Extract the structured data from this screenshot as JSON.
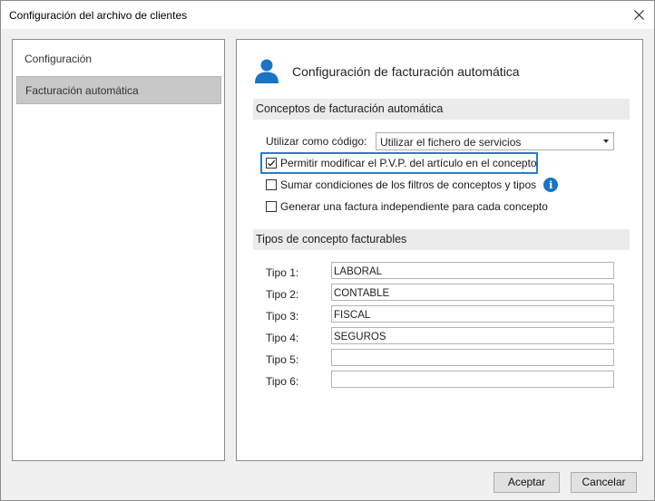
{
  "window": {
    "title": "Configuración del archivo de clientes"
  },
  "sidebar": {
    "items": [
      {
        "label": "Configuración",
        "selected": false
      },
      {
        "label": "Facturación automática",
        "selected": true
      }
    ]
  },
  "main": {
    "header_title": "Configuración de facturación automática",
    "header_icon": "user-icon",
    "concepts_section": {
      "title": "Conceptos de facturación automática",
      "code_label": "Utilizar como código:",
      "code_value": "Utilizar el fichero de servicios",
      "checkboxes": [
        {
          "label": "Permitir modificar el P.V.P. del artículo en el concepto",
          "checked": true
        },
        {
          "label": "Sumar condiciones de los filtros de conceptos y tipos",
          "checked": false
        },
        {
          "label": "Generar una factura independiente para cada concepto",
          "checked": false
        }
      ]
    },
    "types_section": {
      "title": "Tipos de concepto facturables",
      "types": [
        {
          "label": "Tipo 1:",
          "value": "LABORAL"
        },
        {
          "label": "Tipo 2:",
          "value": "CONTABLE"
        },
        {
          "label": "Tipo 3:",
          "value": "FISCAL"
        },
        {
          "label": "Tipo 4:",
          "value": "SEGUROS"
        },
        {
          "label": "Tipo 5:",
          "value": ""
        },
        {
          "label": "Tipo 6:",
          "value": ""
        }
      ]
    }
  },
  "buttons": {
    "accept": "Aceptar",
    "cancel": "Cancelar"
  },
  "colors": {
    "accent": "#2a7cc7",
    "icon_blue": "#1a74c4",
    "selected_bg": "#c8c8c8"
  }
}
